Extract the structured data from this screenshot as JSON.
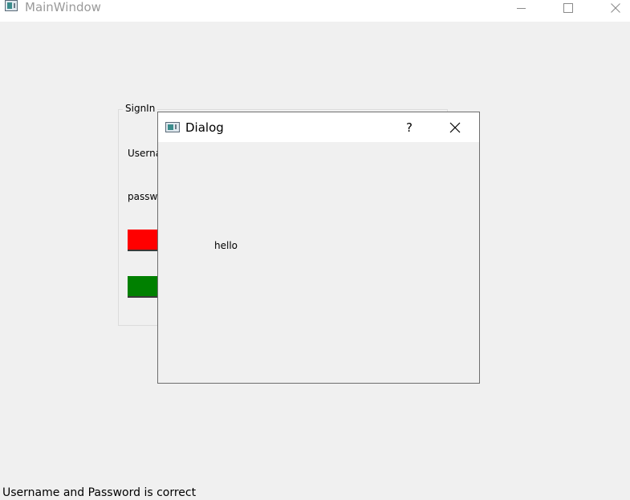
{
  "window": {
    "title": "MainWindow",
    "icon": "app-window-icon",
    "controls": {
      "minimize_icon": "minimize-icon",
      "maximize_icon": "maximize-icon",
      "close_icon": "close-icon"
    }
  },
  "signin_group": {
    "title": "SignIn",
    "username_label": "Userna",
    "password_label": "passw",
    "red_button": {
      "color": "#ff0000"
    },
    "green_button": {
      "color": "#008000"
    }
  },
  "dialog": {
    "title": "Dialog",
    "icon": "dialog-window-icon",
    "help_label": "?",
    "close_icon": "close-icon",
    "message": "hello"
  },
  "statusbar": {
    "message": "Username and Password is correct"
  }
}
